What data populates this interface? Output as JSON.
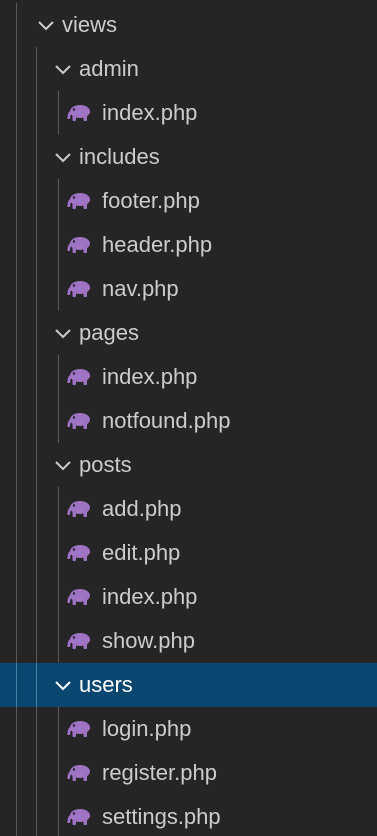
{
  "explorer": {
    "root": {
      "label": "views",
      "expanded": true
    },
    "folders": [
      {
        "label": "admin",
        "expanded": true,
        "files": [
          "index.php"
        ]
      },
      {
        "label": "includes",
        "expanded": true,
        "files": [
          "footer.php",
          "header.php",
          "nav.php"
        ]
      },
      {
        "label": "pages",
        "expanded": true,
        "files": [
          "index.php",
          "notfound.php"
        ]
      },
      {
        "label": "posts",
        "expanded": true,
        "files": [
          "add.php",
          "edit.php",
          "index.php",
          "show.php"
        ]
      },
      {
        "label": "users",
        "expanded": true,
        "selected": true,
        "files": [
          "login.php",
          "register.php",
          "settings.php"
        ]
      }
    ]
  },
  "icons": {
    "chevron": "chevron-down-icon",
    "file": "php-elephant-icon"
  },
  "colors": {
    "sidebar_background": "#252526",
    "selection_background": "#094771",
    "text": "#cccccc",
    "selected_text": "#ffffff",
    "indent_guide": "#585858",
    "php_icon": "#a074c4"
  }
}
